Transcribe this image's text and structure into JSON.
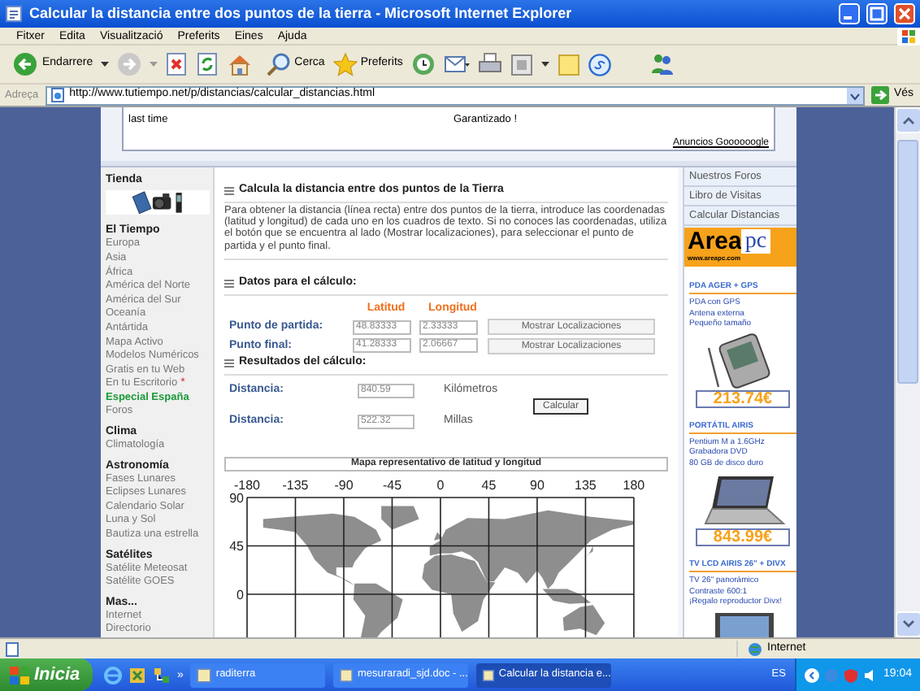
{
  "window": {
    "title": "Calcular la distancia entre dos puntos de la tierra - Microsoft Internet Explorer"
  },
  "menu": [
    "Fitxer",
    "Edita",
    "Visualització",
    "Preferits",
    "Eines",
    "Ajuda"
  ],
  "toolbar": {
    "back": "Endarrere",
    "search": "Cerca",
    "favorites": "Preferits"
  },
  "address": {
    "label": "Adreça",
    "url": "http://www.tutiempo.net/p/distancias/calcular_distancias.html",
    "go": "Vés"
  },
  "ads": {
    "left": [
      "last time"
    ],
    "right": [
      "Garantizado !"
    ],
    "footer": "Anuncios Goooooogle"
  },
  "sidebar": {
    "shop_title": "Tienda",
    "sections": [
      {
        "title": "El Tiempo",
        "items": [
          {
            "label": "Europa",
            "kind": "link"
          },
          {
            "label": "Asia",
            "kind": "link"
          },
          {
            "label": "África",
            "kind": "link"
          },
          {
            "label": "América del Norte",
            "kind": "link"
          },
          {
            "label": "América del Sur",
            "kind": "link"
          },
          {
            "label": "Oceanía",
            "kind": "link"
          },
          {
            "label": "Antártida",
            "kind": "link"
          },
          {
            "label": "Mapa Activo",
            "kind": "link"
          },
          {
            "label": "Modelos Numéricos",
            "kind": "link"
          },
          {
            "label": "Gratis en tu Web",
            "kind": "link"
          },
          {
            "label": "En tu Escritorio",
            "kind": "link",
            "mark": "*"
          },
          {
            "label": "Especial España",
            "kind": "special"
          },
          {
            "label": "Foros",
            "kind": "link"
          }
        ]
      },
      {
        "title": "Clima",
        "items": [
          {
            "label": "Climatología",
            "kind": "link"
          }
        ]
      },
      {
        "title": "Astronomía",
        "items": [
          {
            "label": "Fases Lunares",
            "kind": "link"
          },
          {
            "label": "Eclipses Lunares",
            "kind": "link"
          },
          {
            "label": "Calendario Solar",
            "kind": "link"
          },
          {
            "label": "Luna y Sol",
            "kind": "link"
          },
          {
            "label": "Bautiza una estrella",
            "kind": "link"
          }
        ]
      },
      {
        "title": "Satélites",
        "items": [
          {
            "label": "Satélite Meteosat",
            "kind": "link"
          },
          {
            "label": "Satélite GOES",
            "kind": "link"
          }
        ]
      },
      {
        "title": "Mas...",
        "items": [
          {
            "label": "Internet",
            "kind": "link"
          },
          {
            "label": "Directorio",
            "kind": "link"
          }
        ]
      }
    ]
  },
  "main": {
    "title": "Calcula la distancia entre dos puntos de la Tierra",
    "intro": "Para obtener la distancia (línea recta) entre dos puntos de la tierra, introduce las coordenadas (latitud y longitud) de cada uno en los cuadros de texto. Si no conoces las coordenadas, utiliza el botón que se encuentra al lado (Mostrar localizaciones), para seleccionar el punto de partida y el punto final.",
    "data_title": "Datos para el cálculo:",
    "columns": [
      "Latitud",
      "Longitud"
    ],
    "points": [
      {
        "label": "Punto de partida:",
        "lat": "48.83333",
        "lon": "2.33333",
        "button": "Mostrar Localizaciones"
      },
      {
        "label": "Punto final:",
        "lat": "41.28333",
        "lon": "2.06667",
        "button": "Mostrar Localizaciones"
      }
    ],
    "results_title": "Resultados del cálculo:",
    "results": [
      {
        "label": "Distancia:",
        "value": "840.59",
        "unit": "Kilómetros"
      },
      {
        "label": "Distancia:",
        "value": "522.32",
        "unit": "Millas"
      }
    ],
    "calculate": "Calcular",
    "map": {
      "title": "Mapa representativo de latitud y longitud",
      "x_labels": [
        "-180",
        "-135",
        "-90",
        "-45",
        "0",
        "45",
        "90",
        "135",
        "180"
      ],
      "y_labels": [
        "90",
        "45",
        "0"
      ]
    }
  },
  "right": {
    "links": [
      "Nuestros Foros",
      "Libro de Visitas",
      "Calcular Distancias"
    ],
    "logo": {
      "word": "Area",
      "suffix": "pc",
      "url": "www.areapc.com"
    },
    "products": [
      {
        "title": "PDA AGER + GPS",
        "lines": [
          "PDA con GPS",
          "Antena externa",
          "Pequeño tamaño"
        ],
        "price": "213.74€",
        "kind": "pda"
      },
      {
        "title": "PORTÁTIL AIRIS",
        "lines": [
          "Pentium M a 1.6GHz",
          "Grabadora DVD",
          "80 GB de disco duro"
        ],
        "price": "843.99€",
        "kind": "laptop"
      },
      {
        "title": "TV LCD AIRIS 26\" + DIVX",
        "lines": [
          "TV 26\" panorámico",
          "Contraste 600:1",
          "¡Regalo reproductor Divx!"
        ],
        "kind": "tv"
      }
    ]
  },
  "status_bar": {
    "zone": "Internet"
  },
  "taskbar": {
    "start": "Inicia",
    "more": "»",
    "tasks": [
      {
        "label": "raditerra",
        "selected": false
      },
      {
        "label": "mesuraradi_sjd.doc - ...",
        "selected": false
      },
      {
        "label": "Calcular la distancia e...",
        "selected": true
      }
    ],
    "language": "ES",
    "clock": "19:04"
  }
}
